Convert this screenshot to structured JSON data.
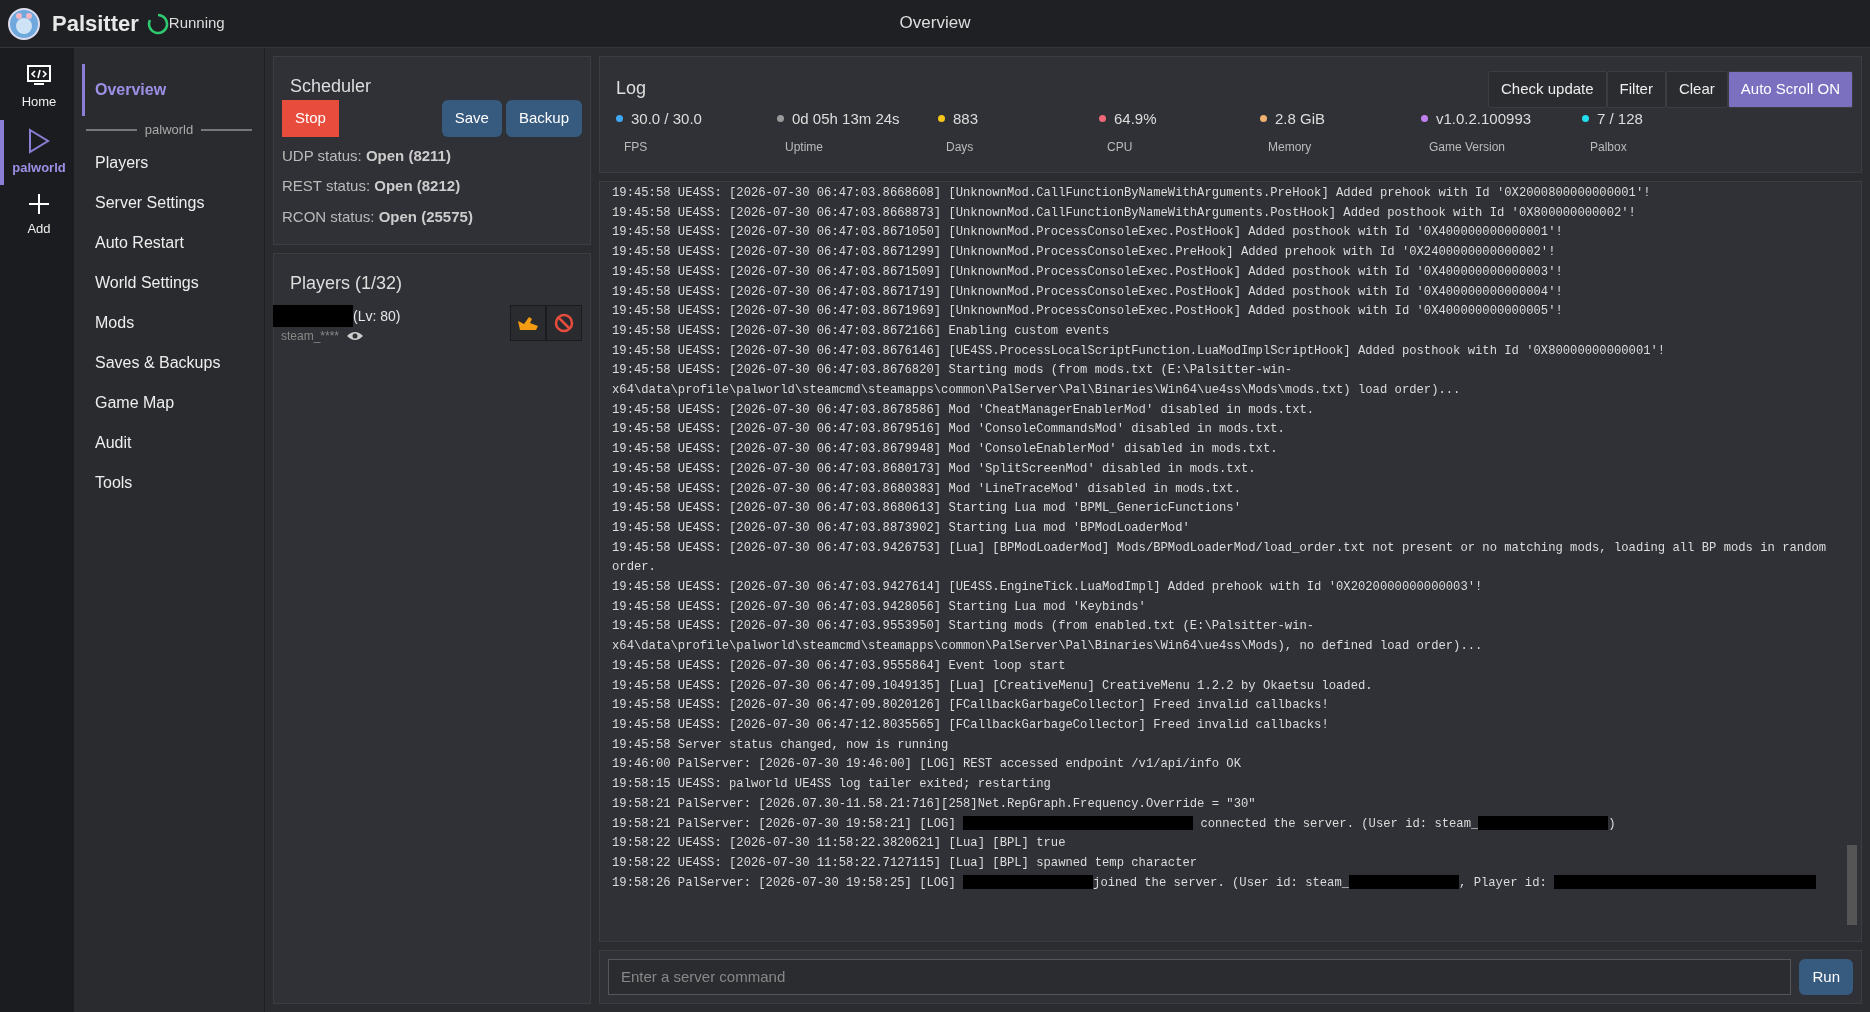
{
  "header": {
    "app_name": "Palsitter",
    "status": "Running",
    "title": "Overview"
  },
  "rail": [
    {
      "label": "Home",
      "selected": false
    },
    {
      "label": "palworld",
      "selected": true
    },
    {
      "label": "Add",
      "selected": false
    }
  ],
  "nav": {
    "items": [
      {
        "label": "Overview",
        "selected": true
      }
    ],
    "group": "palworld",
    "group_items": [
      {
        "label": "Players",
        "selected": false
      },
      {
        "label": "Server Settings",
        "selected": false
      },
      {
        "label": "Auto Restart",
        "selected": false
      },
      {
        "label": "World Settings",
        "selected": false
      },
      {
        "label": "Mods",
        "selected": false
      },
      {
        "label": "Saves & Backups",
        "selected": false
      },
      {
        "label": "Game Map",
        "selected": false
      },
      {
        "label": "Audit",
        "selected": false
      },
      {
        "label": "Tools",
        "selected": false
      }
    ]
  },
  "scheduler": {
    "title": "Scheduler",
    "buttons": [
      {
        "label": "Stop",
        "kind": "danger"
      },
      {
        "label": "Save",
        "kind": "primary"
      },
      {
        "label": "Backup",
        "kind": "primary"
      }
    ],
    "statuses": [
      {
        "label": "UDP status:",
        "value": "Open (8211)"
      },
      {
        "label": "REST status:",
        "value": "Open (8212)"
      },
      {
        "label": "RCON status:",
        "value": "Open (25575)"
      }
    ]
  },
  "players": {
    "title": "Players (1/32)",
    "list": [
      {
        "level": "(Lv: 80)",
        "id": "steam_****"
      }
    ]
  },
  "log": {
    "title": "Log",
    "buttons": [
      {
        "label": "Check update",
        "selected": false
      },
      {
        "label": "Filter",
        "selected": false
      },
      {
        "label": "Clear",
        "selected": false
      },
      {
        "label": "Auto Scroll ON",
        "selected": true
      }
    ],
    "stats": [
      {
        "value": "30.0 / 30.0",
        "label": "FPS",
        "color": "#3fa9f5"
      },
      {
        "value": "0d 05h 13m 24s",
        "label": "Uptime",
        "color": "#9a9a9a"
      },
      {
        "value": "883",
        "label": "Days",
        "color": "#f5c518"
      },
      {
        "value": "64.9%",
        "label": "CPU",
        "color": "#f06878"
      },
      {
        "value": "2.8 GiB",
        "label": "Memory",
        "color": "#f0b070"
      },
      {
        "value": "v1.0.2.100993",
        "label": "Game Version",
        "color": "#c080f0"
      },
      {
        "value": "7 / 128",
        "label": "Palbox",
        "color": "#20e0f0"
      }
    ],
    "lines": [
      "19:45:58 UE4SS: [2026-07-30 06:47:03.8668608] [UnknownMod.CallFunctionByNameWithArguments.PreHook] Added prehook with Id '0X2000800000000001'!",
      "19:45:58 UE4SS: [2026-07-30 06:47:03.8668873] [UnknownMod.CallFunctionByNameWithArguments.PostHook] Added posthook with Id '0X800000000002'!",
      "19:45:58 UE4SS: [2026-07-30 06:47:03.8671050] [UnknownMod.ProcessConsoleExec.PostHook] Added posthook with Id '0X400000000000001'!",
      "19:45:58 UE4SS: [2026-07-30 06:47:03.8671299] [UnknownMod.ProcessConsoleExec.PreHook] Added prehook with Id '0X2400000000000002'!",
      "19:45:58 UE4SS: [2026-07-30 06:47:03.8671509] [UnknownMod.ProcessConsoleExec.PostHook] Added posthook with Id '0X400000000000003'!",
      "19:45:58 UE4SS: [2026-07-30 06:47:03.8671719] [UnknownMod.ProcessConsoleExec.PostHook] Added posthook with Id '0X400000000000004'!",
      "19:45:58 UE4SS: [2026-07-30 06:47:03.8671969] [UnknownMod.ProcessConsoleExec.PostHook] Added posthook with Id '0X400000000000005'!",
      "19:45:58 UE4SS: [2026-07-30 06:47:03.8672166] Enabling custom events",
      "19:45:58 UE4SS: [2026-07-30 06:47:03.8676146] [UE4SS.ProcessLocalScriptFunction.LuaModImplScriptHook] Added posthook with Id '0X80000000000001'!",
      "19:45:58 UE4SS: [2026-07-30 06:47:03.8676820] Starting mods (from mods.txt (E:\\Palsitter-win-x64\\data\\profile\\palworld\\steamcmd\\steamapps\\common\\PalServer\\Pal\\Binaries\\Win64\\ue4ss\\Mods\\mods.txt) load order)...",
      "19:45:58 UE4SS: [2026-07-30 06:47:03.8678586] Mod 'CheatManagerEnablerMod' disabled in mods.txt.",
      "19:45:58 UE4SS: [2026-07-30 06:47:03.8679516] Mod 'ConsoleCommandsMod' disabled in mods.txt.",
      "19:45:58 UE4SS: [2026-07-30 06:47:03.8679948] Mod 'ConsoleEnablerMod' disabled in mods.txt.",
      "19:45:58 UE4SS: [2026-07-30 06:47:03.8680173] Mod 'SplitScreenMod' disabled in mods.txt.",
      "19:45:58 UE4SS: [2026-07-30 06:47:03.8680383] Mod 'LineTraceMod' disabled in mods.txt.",
      "19:45:58 UE4SS: [2026-07-30 06:47:03.8680613] Starting Lua mod 'BPML_GenericFunctions'",
      "19:45:58 UE4SS: [2026-07-30 06:47:03.8873902] Starting Lua mod 'BPModLoaderMod'",
      "19:45:58 UE4SS: [2026-07-30 06:47:03.9426753] [Lua] [BPModLoaderMod] Mods/BPModLoaderMod/load_order.txt not present or no matching mods, loading all BP mods in random order.",
      "19:45:58 UE4SS: [2026-07-30 06:47:03.9427614] [UE4SS.EngineTick.LuaModImpl] Added prehook with Id '0X2020000000000003'!",
      "19:45:58 UE4SS: [2026-07-30 06:47:03.9428056] Starting Lua mod 'Keybinds'",
      "19:45:58 UE4SS: [2026-07-30 06:47:03.9553950] Starting mods (from enabled.txt (E:\\Palsitter-win-x64\\data\\profile\\palworld\\steamcmd\\steamapps\\common\\PalServer\\Pal\\Binaries\\Win64\\ue4ss\\Mods), no defined load order)...",
      "19:45:58 UE4SS: [2026-07-30 06:47:03.9555864] Event loop start",
      "19:45:58 UE4SS: [2026-07-30 06:47:09.1049135] [Lua] [CreativeMenu] CreativeMenu 1.2.2 by Okaetsu loaded.",
      "19:45:58 UE4SS: [2026-07-30 06:47:09.8020126] [FCallbackGarbageCollector] Freed invalid callbacks!",
      "19:45:58 UE4SS: [2026-07-30 06:47:12.8035565] [FCallbackGarbageCollector] Freed invalid callbacks!",
      "19:45:58 Server status changed, now is running",
      "19:46:00 PalServer: [2026-07-30 19:46:00] [LOG] REST accessed endpoint /v1/api/info OK",
      "19:58:15 UE4SS: palworld UE4SS log tailer exited; restarting",
      "19:58:21 PalServer: [2026.07.30-11.58.21:716][258]Net.RepGraph.Frequency.Override = \"30\"",
      {
        "segments": [
          {
            "text": "19:58:21 PalServer: [2026-07-30 19:58:21] [LOG] "
          },
          {
            "kind": "redacted"
          },
          {
            "text": " connected the server. (User id: steam_"
          },
          {
            "kind": "redacted"
          },
          {
            "text": ")"
          }
        ]
      },
      "19:58:22 UE4SS: [2026-07-30 11:58:22.3820621] [Lua] [BPL] true",
      "19:58:22 UE4SS: [2026-07-30 11:58:22.7127115] [Lua] [BPL] spawned temp character",
      {
        "segments": [
          {
            "text": "19:58:26 PalServer: [2026-07-30 19:58:25] [LOG] "
          },
          {
            "kind": "redacted"
          },
          {
            "text": "joined the server. (User id: steam_"
          },
          {
            "kind": "redacted"
          },
          {
            "text": ", Player id: "
          },
          {
            "kind": "redacted"
          }
        ]
      }
    ],
    "command": {
      "placeholder": "Enter a server command",
      "button": "Run"
    }
  }
}
